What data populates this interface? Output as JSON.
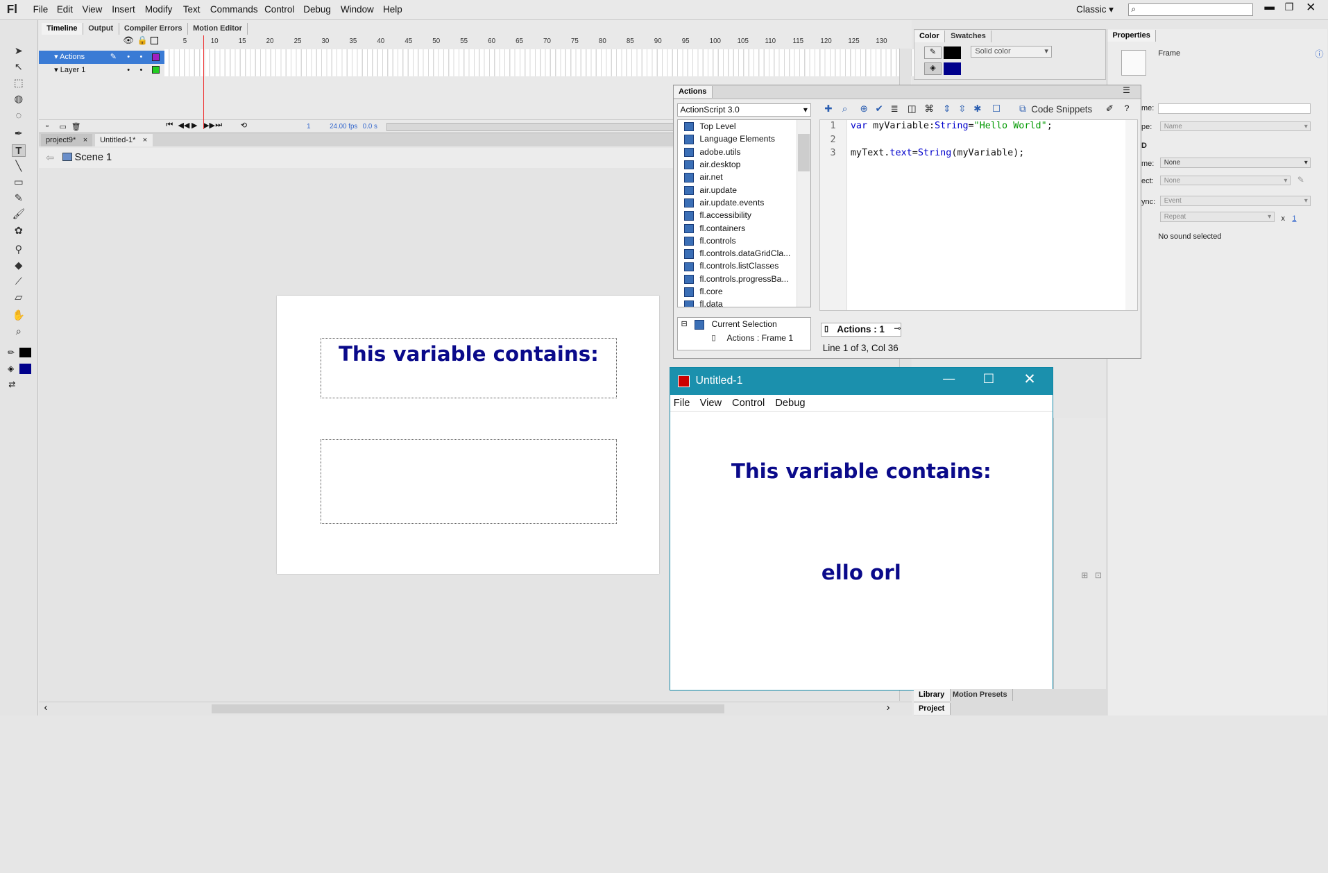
{
  "app": {
    "logo": "Fl",
    "workspace": "Classic"
  },
  "menu": [
    "File",
    "Edit",
    "View",
    "Insert",
    "Modify",
    "Text",
    "Commands",
    "Control",
    "Debug",
    "Window",
    "Help"
  ],
  "timeline": {
    "tabs": [
      "Timeline",
      "Output",
      "Compiler Errors",
      "Motion Editor"
    ],
    "ruler": [
      "5",
      "10",
      "15",
      "20",
      "25",
      "30",
      "35",
      "40",
      "45",
      "50",
      "55",
      "60",
      "65",
      "70",
      "75",
      "80",
      "85",
      "90",
      "95",
      "100",
      "105",
      "110",
      "115",
      "120",
      "125",
      "130"
    ],
    "layers": [
      "Actions",
      "Layer 1"
    ],
    "frame": "1",
    "fps": "24.00 fps",
    "time": "0.0 s"
  },
  "docs": {
    "tabs": [
      "project9*",
      "Untitled-1*"
    ],
    "scene": "Scene 1"
  },
  "stage": {
    "heading": "This variable contains:"
  },
  "color_panel": {
    "tabs": [
      "Color",
      "Swatches"
    ],
    "fill_type": "Solid color",
    "stroke": "#000000",
    "fill": "#00008b"
  },
  "properties": {
    "title": "Properties",
    "frame_label": "Frame",
    "name_label": "me:",
    "type_label": "pe:",
    "type_value": "Name",
    "section": "D",
    "sound_name_label": "me:",
    "sound_name_value": "None",
    "effect_label": "ect:",
    "effect_value": "None",
    "sync_label": "ync:",
    "sync_value": "Event",
    "repeat_value": "Repeat",
    "repeat_x": "x",
    "repeat_count": "1",
    "status": "No sound selected"
  },
  "actions": {
    "title": "Actions",
    "language": "ActionScript 3.0",
    "code_snippets": "Code Snippets",
    "library": [
      "Top Level",
      "Language Elements",
      "adobe.utils",
      "air.desktop",
      "air.net",
      "air.update",
      "air.update.events",
      "fl.accessibility",
      "fl.containers",
      "fl.controls",
      "fl.controls.dataGridCla...",
      "fl.controls.listClasses",
      "fl.controls.progressBa...",
      "fl.core",
      "fl.data"
    ],
    "current_selection": "Current Selection",
    "current_item": "Actions : Frame 1",
    "tab": "Actions : 1",
    "status": "Line 1 of 3, Col 36",
    "line_numbers": [
      "1",
      "2",
      "3"
    ],
    "code": {
      "l1_kw": "var ",
      "l1_id": "myVariable:",
      "l1_type": "String",
      "l1_eq": "=",
      "l1_str": "\"Hello World\"",
      "l1_end": ";",
      "l3_obj": "myText.",
      "l3_prop": "text",
      "l3_eq": "=",
      "l3_fn": "String",
      "l3_arg": "(myVariable);"
    }
  },
  "preview": {
    "title": "Untitled-1",
    "menu": [
      "File",
      "View",
      "Control",
      "Debug"
    ],
    "heading": "This variable contains:",
    "output": "ello orl"
  },
  "bottom": {
    "tabs": [
      "Library",
      "Motion Presets"
    ],
    "project": "Project"
  }
}
